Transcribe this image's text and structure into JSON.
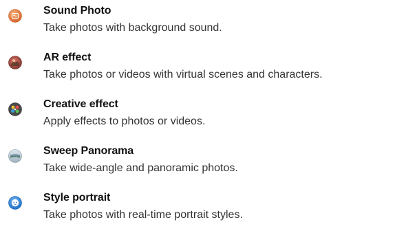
{
  "modes": [
    {
      "title": "Sound Photo",
      "description": "Take photos with background sound.",
      "icon": "sound-photo-icon",
      "color": "#e8864a"
    },
    {
      "title": "AR effect",
      "description": "Take photos or videos with virtual scenes and characters.",
      "icon": "ar-effect-icon",
      "color": "#c0564a"
    },
    {
      "title": "Creative effect",
      "description": "Apply effects to photos or videos.",
      "icon": "creative-effect-icon",
      "color": "#5a5a5a"
    },
    {
      "title": "Sweep Panorama",
      "description": "Take wide-angle and panoramic photos.",
      "icon": "sweep-panorama-icon",
      "color": "#8ab0c8"
    },
    {
      "title": "Style portrait",
      "description": "Take photos with real-time portrait styles.",
      "icon": "style-portrait-icon",
      "color": "#3a8ee0"
    }
  ]
}
